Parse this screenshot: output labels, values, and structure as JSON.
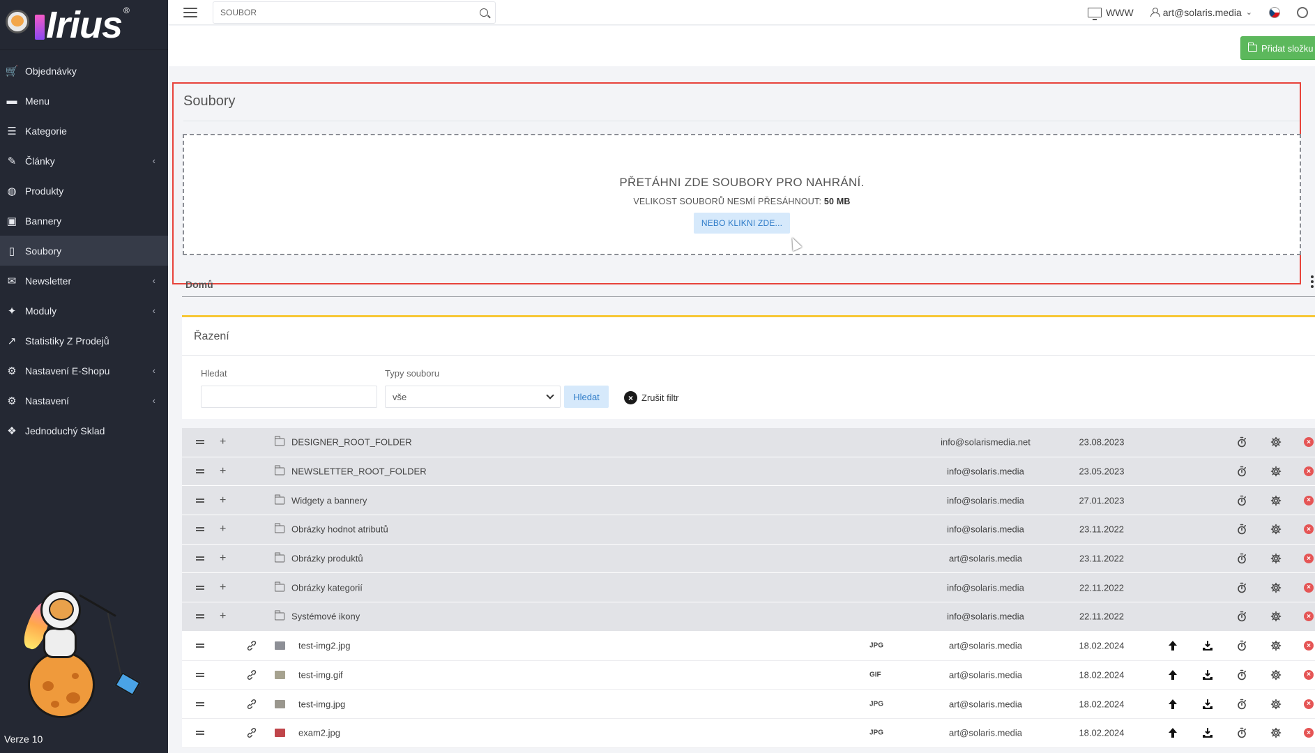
{
  "app": {
    "logo_text": "Irius",
    "version": "Verze 10"
  },
  "sidebar": {
    "items": [
      {
        "label": "Objednávky",
        "icon": "cart-icon",
        "chevron": false,
        "active": false
      },
      {
        "label": "Menu",
        "icon": "folder-icon",
        "chevron": false,
        "active": false
      },
      {
        "label": "Kategorie",
        "icon": "list-icon",
        "chevron": false,
        "active": false
      },
      {
        "label": "Články",
        "icon": "pencil-icon",
        "chevron": true,
        "active": false
      },
      {
        "label": "Produkty",
        "icon": "dribbble-icon",
        "chevron": false,
        "active": false
      },
      {
        "label": "Bannery",
        "icon": "image-icon",
        "chevron": false,
        "active": false
      },
      {
        "label": "Soubory",
        "icon": "file-icon",
        "chevron": false,
        "active": true
      },
      {
        "label": "Newsletter",
        "icon": "newsletter-icon",
        "chevron": true,
        "active": false
      },
      {
        "label": "Moduly",
        "icon": "puzzle-icon",
        "chevron": true,
        "active": false
      },
      {
        "label": "Statistiky Z Prodejů",
        "icon": "chart-line-icon",
        "chevron": false,
        "active": false
      },
      {
        "label": "Nastavení E-Shopu",
        "icon": "cogs-icon",
        "chevron": true,
        "active": false
      },
      {
        "label": "Nastavení",
        "icon": "cogs-icon",
        "chevron": true,
        "active": false
      },
      {
        "label": "Jednoduchý Sklad",
        "icon": "boxes-icon",
        "chevron": false,
        "active": false
      }
    ]
  },
  "topbar": {
    "search_placeholder": "SOUBOR",
    "www_label": "WWW",
    "user_label": "art@solaris.media"
  },
  "actions": {
    "add_folder_label": "Přidat složku"
  },
  "upload": {
    "title": "Soubory",
    "drop_text": "PŘETÁHNI ZDE SOUBORY PRO NAHRÁNÍ.",
    "size_text": "VELIKOST SOUBORŮ NESMÍ PŘESÁHNOUT:",
    "size_limit": "50 MB",
    "click_label": "NEBO KLIKNI ZDE..."
  },
  "breadcrumb": {
    "home": "Domů"
  },
  "filter": {
    "title": "Řazení",
    "search_label": "Hledat",
    "type_label": "Typy souboru",
    "type_value": "vše",
    "search_button": "Hledat",
    "clear_label": "Zrušit filtr"
  },
  "folders": [
    {
      "name": "DESIGNER_ROOT_FOLDER",
      "owner": "info@solarismedia.net",
      "date": "23.08.2023"
    },
    {
      "name": "NEWSLETTER_ROOT_FOLDER",
      "owner": "info@solaris.media",
      "date": "23.05.2023"
    },
    {
      "name": "Widgety a bannery",
      "owner": "info@solaris.media",
      "date": "27.01.2023"
    },
    {
      "name": "Obrázky hodnot atributů",
      "owner": "info@solaris.media",
      "date": "23.11.2022"
    },
    {
      "name": "Obrázky produktů",
      "owner": "art@solaris.media",
      "date": "23.11.2022"
    },
    {
      "name": "Obrázky kategorií",
      "owner": "info@solaris.media",
      "date": "22.11.2022"
    },
    {
      "name": "Systémové ikony",
      "owner": "info@solaris.media",
      "date": "22.11.2022"
    }
  ],
  "files": [
    {
      "name": "test-img2.jpg",
      "type": "JPG",
      "owner": "art@solaris.media",
      "date": "18.02.2024",
      "thumb_color": "#8d8f96"
    },
    {
      "name": "test-img.gif",
      "type": "GIF",
      "owner": "art@solaris.media",
      "date": "18.02.2024",
      "thumb_color": "#a6a28f"
    },
    {
      "name": "test-img.jpg",
      "type": "JPG",
      "owner": "art@solaris.media",
      "date": "18.02.2024",
      "thumb_color": "#9a978e"
    },
    {
      "name": "exam2.jpg",
      "type": "JPG",
      "owner": "art@solaris.media",
      "date": "18.02.2024",
      "thumb_color": "#c0454a"
    }
  ],
  "colors": {
    "sidebar_bg": "#242833",
    "accent_green": "#5cb85c",
    "highlight_red": "#e8433b",
    "filter_accent": "#f7c735"
  }
}
